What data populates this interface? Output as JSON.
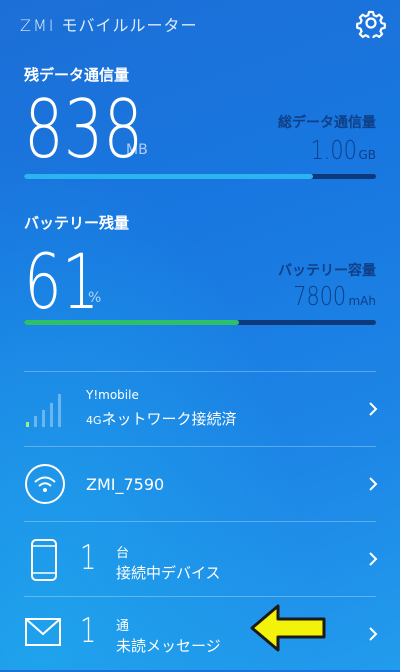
{
  "header": {
    "logo": "ZMI",
    "title": "モバイルルーター",
    "settings_icon": "gear-icon"
  },
  "data_usage": {
    "label": "残データ通信量",
    "value": "838",
    "unit": "MB",
    "total_label": "総データ通信量",
    "total_value": "1.00",
    "total_unit": "GB",
    "progress": 0.82,
    "color": "#2ab4f0"
  },
  "battery": {
    "label": "バッテリー残量",
    "value": "61",
    "unit": "%",
    "capacity_label": "バッテリー容量",
    "capacity_value": "7800",
    "capacity_unit": "mAh",
    "progress": 0.61,
    "color": "#2dbf6a"
  },
  "network": {
    "carrier": "Y!mobile",
    "gen": "4G",
    "status": "ネットワーク接続済",
    "signal_icon": "signal-bars-icon"
  },
  "wifi": {
    "ssid": "ZMI_7590",
    "icon": "wifi-icon"
  },
  "devices": {
    "count": "1",
    "unit": "台",
    "label": "接続中デバイス",
    "icon": "phone-icon"
  },
  "messages": {
    "count": "1",
    "unit": "通",
    "label": "未読メッセージ",
    "icon": "mail-icon",
    "annotation": "yellow-arrow"
  }
}
